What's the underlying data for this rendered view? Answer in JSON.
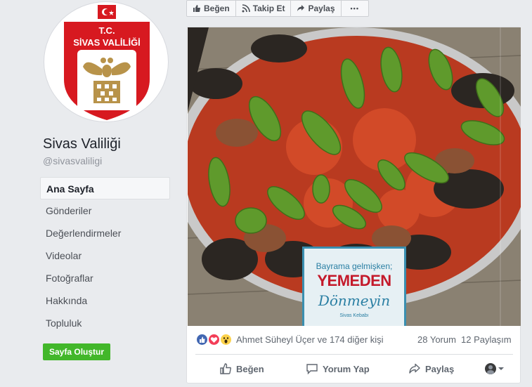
{
  "page": {
    "name": "Sivas Valiliği",
    "handle": "@sivasvaliligi",
    "logo": {
      "top_text": "T.C.",
      "main_text": "SİVAS VALİLİĞİ"
    }
  },
  "nav": {
    "items": [
      {
        "label": "Ana Sayfa",
        "active": true
      },
      {
        "label": "Gönderiler"
      },
      {
        "label": "Değerlendirmeler"
      },
      {
        "label": "Videolar"
      },
      {
        "label": "Fotoğraflar"
      },
      {
        "label": "Hakkında"
      },
      {
        "label": "Topluluk"
      }
    ],
    "create_page_label": "Sayfa Oluştur"
  },
  "actionbar": {
    "like_label": "Beğen",
    "follow_label": "Takip Et",
    "share_label": "Paylaş",
    "more_label": "•••"
  },
  "post": {
    "overlay": {
      "line1": "Bayrama gelmişken;",
      "line2": "YEMEDEN",
      "line3": "Dönmeyin",
      "line4": "Sivas Kebabı"
    },
    "reactions_text": "Ahmet Süheyl Üçer ve 174 diğer kişi",
    "comments": "28 Yorum",
    "shares": "12 Paylaşım",
    "actions": {
      "like": "Beğen",
      "comment": "Yorum Yap",
      "share": "Paylaş"
    }
  },
  "colors": {
    "like_blue": "#4267b2",
    "love_red": "#f33e58",
    "wow_yellow": "#fcd24b",
    "create_green": "#42b72a",
    "logo_red": "#d71920",
    "logo_gold": "#b8934a"
  }
}
